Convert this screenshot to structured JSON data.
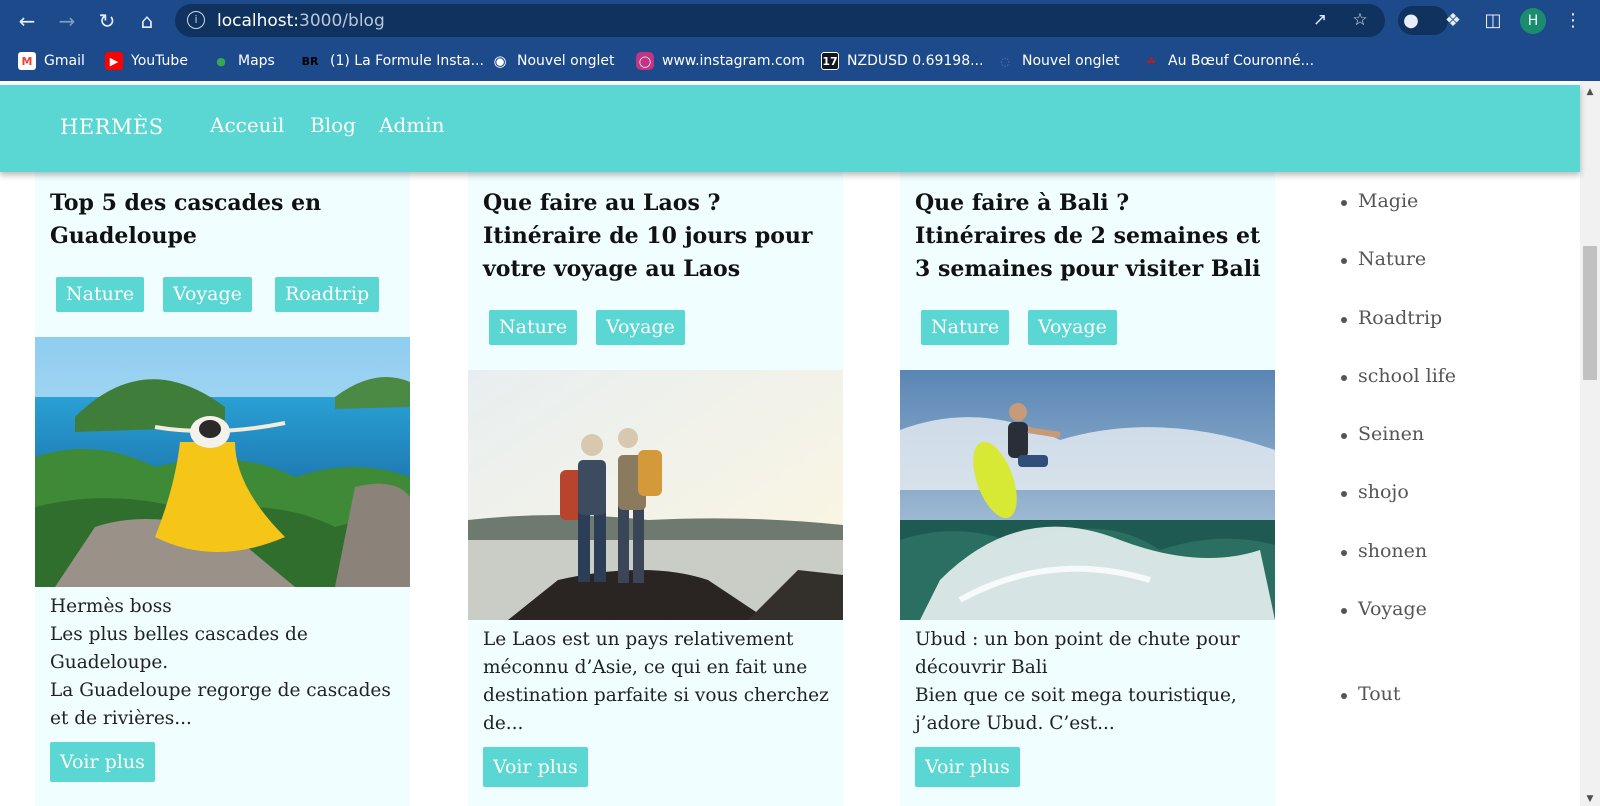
{
  "browser": {
    "url_host": "localhost:",
    "url_path": "3000/blog",
    "nav_icons": [
      "back-icon",
      "forward-icon",
      "reload-icon",
      "home-icon"
    ],
    "profile_initial": "H",
    "accent": "#1c4a8a"
  },
  "bookmarks": [
    {
      "label": "Gmail",
      "icon": "gmail-icon",
      "color": "#ea4335"
    },
    {
      "label": "YouTube",
      "icon": "youtube-icon",
      "color": "#ff0000"
    },
    {
      "label": "Maps",
      "icon": "maps-icon",
      "color": "#34a853"
    },
    {
      "label": "(1) La Formule Insta...",
      "icon": "br-icon",
      "color": "#000000"
    },
    {
      "label": "Nouvel onglet",
      "icon": "globe-icon",
      "color": "#ffffff"
    },
    {
      "label": "www.instagram.com",
      "icon": "instagram-icon",
      "color": "#c13584"
    },
    {
      "label": "NZDUSD 0.69198...",
      "icon": "tradingview-icon",
      "color": "#131722"
    },
    {
      "label": "Nouvel onglet",
      "icon": "tab-icon",
      "color": "#6a7fa8"
    },
    {
      "label": "Au Bœuf Couronné...",
      "icon": "restaurant-icon",
      "color": "#b22222"
    }
  ],
  "site": {
    "logo": "HERMÈS",
    "nav": [
      "Acceuil",
      "Blog",
      "Admin"
    ],
    "brand_color": "#5ad6d3"
  },
  "cards": [
    {
      "title": "Top 5 des cascades en Guadeloupe",
      "tags": [
        "Nature",
        "Voyage",
        "Roadtrip"
      ],
      "image": "woman-yellow-dress-island-view",
      "lines": [
        "Hermès boss",
        "Les plus belles cascades de Guadeloupe.",
        "La Guadeloupe regorge de cascades et de rivières..."
      ],
      "button": "Voir plus"
    },
    {
      "title": "Que faire au Laos ? Itinéraire de 10 jours pour votre voyage au Laos",
      "tags": [
        "Nature",
        "Voyage"
      ],
      "image": "hikers-on-rock-at-sunset",
      "lines": [
        "Le Laos est un pays relativement méconnu d’Asie, ce qui en fait une destination parfaite si vous cherchez de..."
      ],
      "button": "Voir plus"
    },
    {
      "title": "Que faire à Bali ? Itinéraires de 2 semaines et 3 semaines pour visiter Bali",
      "tags": [
        "Nature",
        "Voyage"
      ],
      "image": "surfer-on-wave",
      "lines": [
        "Ubud : un bon point de chute pour découvrir Bali",
        "Bien que ce soit mega touristique, j’adore Ubud. C’est..."
      ],
      "button": "Voir plus"
    }
  ],
  "sidebar": {
    "categories": [
      "Magie",
      "Nature",
      "Roadtrip",
      "school life",
      "Seinen",
      "shojo",
      "shonen",
      "Voyage"
    ],
    "all_label": "Tout"
  }
}
